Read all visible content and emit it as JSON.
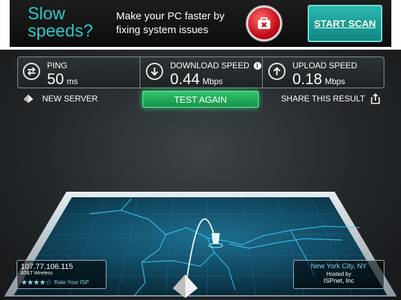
{
  "ad": {
    "headline": "Slow speeds?",
    "pitch": "Make your PC faster by fixing system issues",
    "cta": "START SCAN",
    "icon": "toolkit-icon",
    "accent": "#2ec8c8"
  },
  "stats": {
    "ping": {
      "label": "PING",
      "value": "50",
      "unit": "ms",
      "icon": "swap-arrows-icon"
    },
    "download": {
      "label": "DOWNLOAD SPEED",
      "value": "0.44",
      "unit": "Mbps",
      "icon": "arrow-down-icon",
      "info": "i"
    },
    "upload": {
      "label": "UPLOAD SPEED",
      "value": "0.18",
      "unit": "Mbps",
      "icon": "arrow-up-icon"
    }
  },
  "actions": {
    "new_server": "NEW SERVER",
    "test_again": "TEST AGAIN",
    "share": "SHARE THIS RESULT"
  },
  "client": {
    "ip": "107.77.106.115",
    "isp": "AT&T Wireless",
    "rating_stars": 4,
    "rating_max": 5,
    "rate_label": "Rate Your ISP"
  },
  "server": {
    "city": "New York City, NY",
    "hosted_by": "Hosted by",
    "host": "ISPnet, Inc"
  },
  "colors": {
    "panel": "#24282b",
    "button_green": "#2fc46a",
    "map_line": "#3bd0ff"
  }
}
